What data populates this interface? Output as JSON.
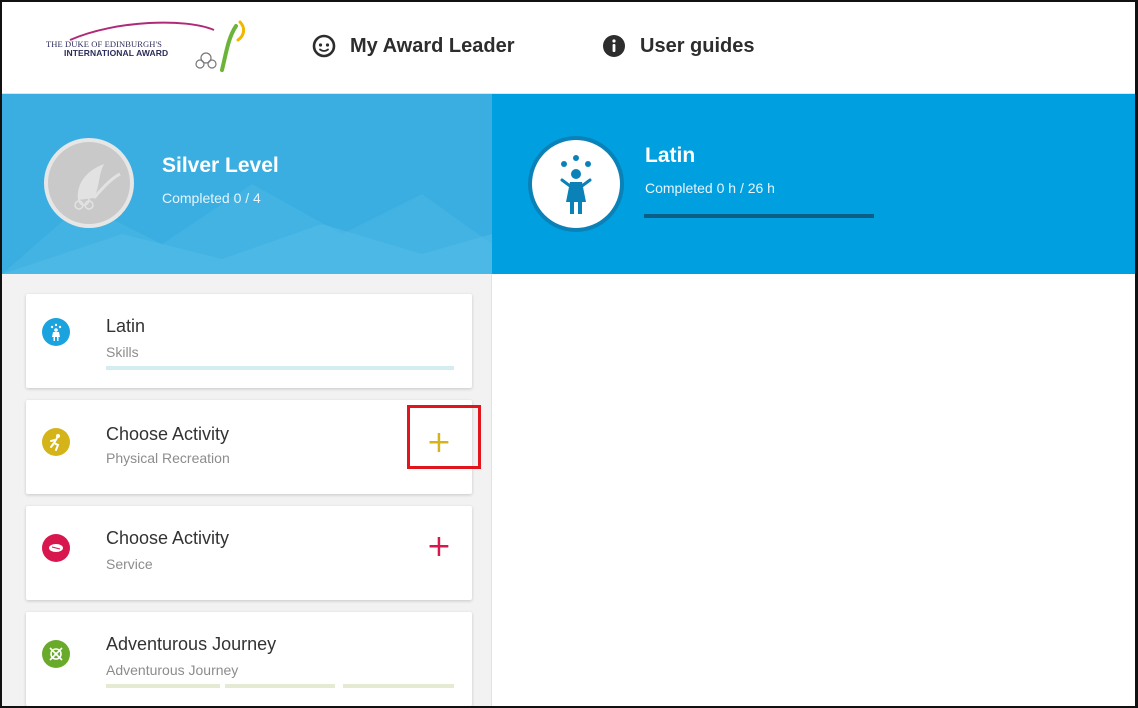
{
  "header": {
    "logo": {
      "line1": "THE DUKE OF EDINBURGH'S",
      "line2": "INTERNATIONAL AWARD"
    },
    "nav": [
      {
        "label": "My Award Leader",
        "icon": "smiley-face-icon"
      },
      {
        "label": "User guides",
        "icon": "info-icon"
      }
    ]
  },
  "hero": {
    "level": {
      "title": "Silver Level",
      "subtitle": "Completed 0 / 4",
      "icon": "silver-award-badge-icon"
    },
    "activity": {
      "title": "Latin",
      "subtitle": "Completed 0 h / 26 h",
      "icon": "juggler-icon",
      "progress": 0
    }
  },
  "sidebar": {
    "cards": [
      {
        "title": "Latin",
        "subtitle": "Skills",
        "icon": "juggler-icon",
        "color": "#1aa3df"
      },
      {
        "title": "Choose Activity",
        "subtitle": "Physical Recreation",
        "icon": "runner-icon",
        "color": "#d4b418",
        "action": "+"
      },
      {
        "title": "Choose Activity",
        "subtitle": "Service",
        "icon": "handshake-icon",
        "color": "#d8174e",
        "action": "+"
      },
      {
        "title": "Adventurous Journey",
        "subtitle": "Adventurous Journey",
        "icon": "compass-icon",
        "color": "#6aaa2a"
      }
    ]
  },
  "colors": {
    "hero_left": "#3aaee0",
    "hero_right": "#009fdf",
    "highlight": "#e0161c"
  }
}
